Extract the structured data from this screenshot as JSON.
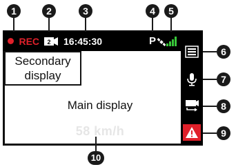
{
  "statusbar": {
    "rec_label": "REC",
    "rec_color": "#e0202a",
    "time": "16:45:30",
    "gps_label": "P",
    "signal_color": "#39c83a",
    "icons": [
      "dual-camera-icon",
      "satellite-icon",
      "signal-icon"
    ]
  },
  "secondary_display": {
    "line1": "Secondary",
    "line2": "display"
  },
  "main_display": {
    "label": "Main display",
    "speed": "58 km/h"
  },
  "sidebar": {
    "buttons": [
      {
        "icon": "menu-icon"
      },
      {
        "icon": "microphone-icon"
      },
      {
        "icon": "switch-camera-icon"
      },
      {
        "icon": "emergency-icon",
        "color": "#e0202a"
      }
    ]
  },
  "callouts": [
    "1",
    "2",
    "3",
    "4",
    "5",
    "6",
    "7",
    "8",
    "9",
    "10"
  ]
}
